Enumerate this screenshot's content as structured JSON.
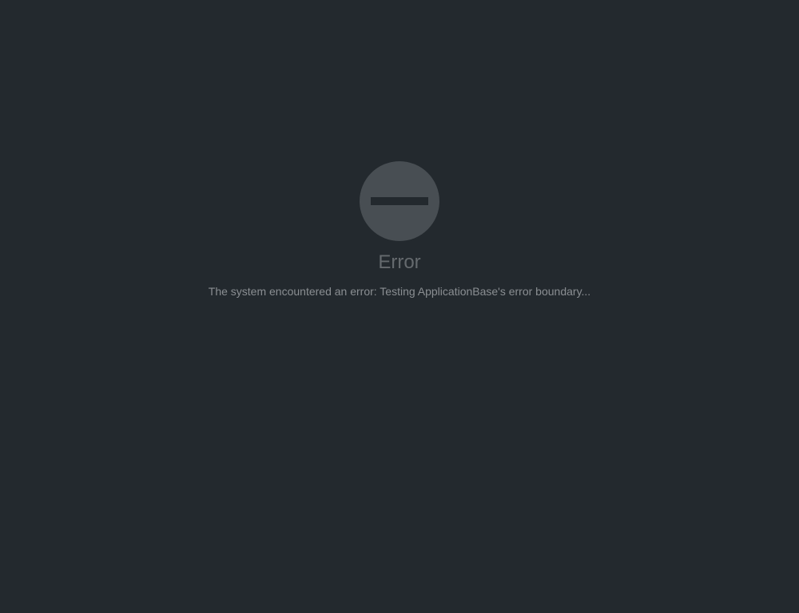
{
  "error": {
    "icon": "no-entry-icon",
    "title": "Error",
    "message": "The system encountered an error: Testing ApplicationBase's error boundary..."
  },
  "colors": {
    "background": "#23292e",
    "icon": "#484e53",
    "title": "#656a6e",
    "message": "#8a8e92"
  }
}
